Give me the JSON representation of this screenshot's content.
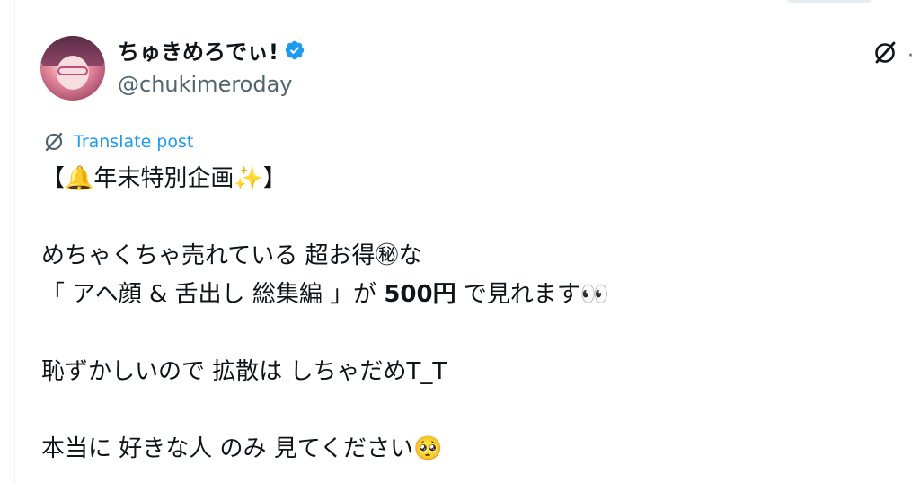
{
  "post": {
    "author": {
      "display_name": "ちゅきめろでぃ!",
      "handle": "@chukimeroday",
      "verified": true
    },
    "translate_label": "Translate post",
    "text_lines": [
      "【🔔年末特別企画✨】",
      "",
      "めちゃくちゃ売れている 超お得㊙な",
      "「 アヘ顔 & 舌出し 総集編 」が 500円 で見れます👀",
      "",
      "恥ずかしいので 拡散は しちゃだめT_T",
      "",
      "本当に 好きな人 のみ 見てください🥺"
    ],
    "line4_pre": "「 アヘ顔 & 舌出し 総集編 」が ",
    "line4_bold": "500円",
    "line4_post": " で見れます👀"
  },
  "colors": {
    "link": "#1d9bf0",
    "secondary_text": "#536471",
    "verified_badge": "#1d9bf0"
  },
  "icons": {
    "avatar": "profile-photo",
    "verified": "verified-badge-icon",
    "more": "grok-icon",
    "translate": "translate-icon"
  }
}
